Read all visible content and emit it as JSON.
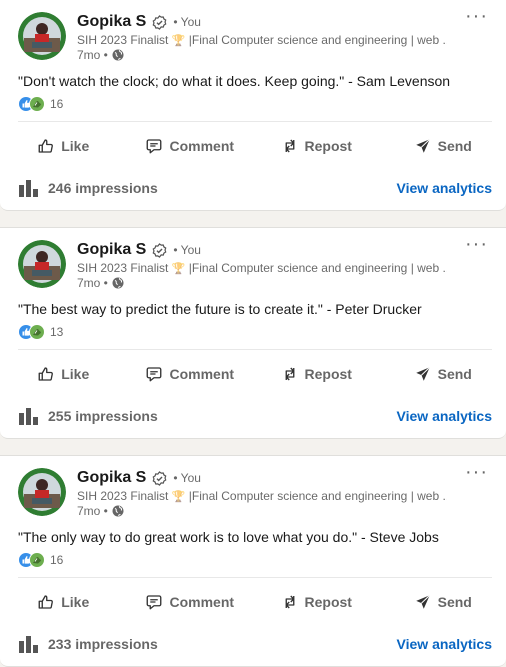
{
  "posts": [
    {
      "author": "Gopika S",
      "you_label": "• You",
      "headline_prefix": "SIH 2023 Finalist",
      "trophy_icon": "🏆",
      "headline_suffix": "|Final Computer science and engineering | web ...",
      "time": "7mo •",
      "content": "\"Don't watch the clock; do what it does. Keep going.\" - Sam Levenson",
      "reaction_count": "16",
      "actions": {
        "like": "Like",
        "comment": "Comment",
        "repost": "Repost",
        "send": "Send"
      },
      "impressions": "246 impressions",
      "analytics_label": "View analytics"
    },
    {
      "author": "Gopika S",
      "you_label": "• You",
      "headline_prefix": "SIH 2023 Finalist",
      "trophy_icon": "🏆",
      "headline_suffix": "|Final Computer science and engineering | web ...",
      "time": "7mo •",
      "content": "\"The best way to predict the future is to create it.\" - Peter Drucker",
      "reaction_count": "13",
      "actions": {
        "like": "Like",
        "comment": "Comment",
        "repost": "Repost",
        "send": "Send"
      },
      "impressions": "255 impressions",
      "analytics_label": "View analytics"
    },
    {
      "author": "Gopika S",
      "you_label": "• You",
      "headline_prefix": "SIH 2023 Finalist",
      "trophy_icon": "🏆",
      "headline_suffix": "|Final Computer science and engineering | web ...",
      "time": "7mo •",
      "content": "\"The only way to do great work is to love what you do.\" - Steve Jobs",
      "reaction_count": "16",
      "actions": {
        "like": "Like",
        "comment": "Comment",
        "repost": "Repost",
        "send": "Send"
      },
      "impressions": "233 impressions",
      "analytics_label": "View analytics"
    }
  ],
  "colors": {
    "link_blue": "#0a66c2",
    "like_blue": "#378fe9",
    "support_green": "#44712e"
  },
  "icons": [
    "more-options-icon",
    "verified-badge-icon",
    "globe-icon",
    "like-reaction-icon",
    "support-reaction-icon",
    "like-icon",
    "comment-icon",
    "repost-icon",
    "send-icon",
    "impressions-chart-icon"
  ]
}
